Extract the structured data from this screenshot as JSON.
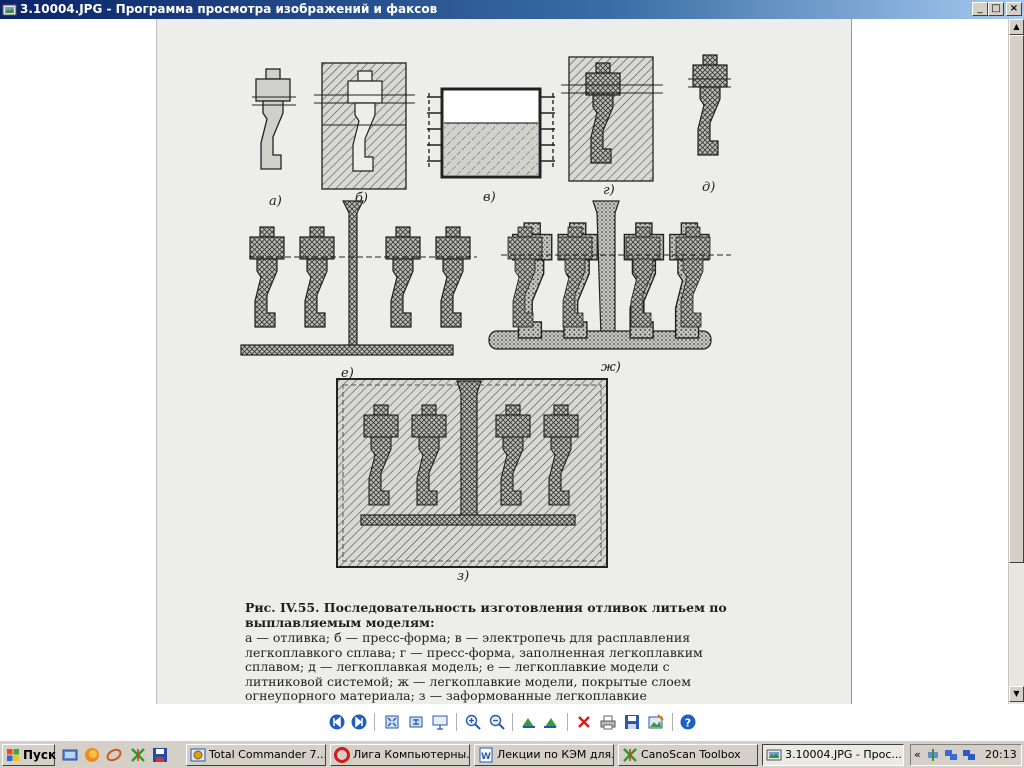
{
  "window": {
    "title": "3.10004.JPG - Программа просмотра изображений и факсов",
    "controls": {
      "minimize": "_",
      "maximize": "□",
      "close": "×"
    }
  },
  "figure": {
    "panel_labels": [
      "а)",
      "б)",
      "в)",
      "г)",
      "д)",
      "е)",
      "ж)",
      "з)"
    ],
    "caption_title": "Рис. IV.55. Последовательность изготовления отливок литьем по выплавляемым моделям:",
    "caption_body": "а — отливка; б — пресс-форма; в — электропечь для расплавления легкоплавкого сплава; г — пресс-форма, заполненная легкоплавким сплавом; д — легкоплавкая модель; е — легкоплавкие модели с литниковой системой; ж — легкоплавкие модели, покрытые слоем огнеупорного материала; з — заформованные легкоплавкие"
  },
  "scrollbar": {
    "up": "▲",
    "down": "▼"
  },
  "toolbar": {
    "icons": [
      "previous-image-icon",
      "next-image-icon",
      "best-fit-icon",
      "actual-size-icon",
      "slideshow-icon",
      "zoom-in-icon",
      "zoom-out-icon",
      "rotate-clockwise-icon",
      "rotate-counterclockwise-icon",
      "delete-icon",
      "print-icon",
      "save-copy-icon",
      "open-for-editing-icon",
      "help-icon"
    ]
  },
  "taskbar": {
    "start_label": "Пуск",
    "tasks": [
      {
        "label": "Total Commander 7....",
        "icon": "total-commander-icon"
      },
      {
        "label": "Лига Компьютерны...",
        "icon": "opera-icon"
      },
      {
        "label": "Лекции по КЭМ для...",
        "icon": "word-icon"
      },
      {
        "label": "CanoScan Toolbox",
        "icon": "canoscan-icon"
      },
      {
        "label": "3.10004.JPG - Прос...",
        "icon": "image-viewer-icon",
        "active": true
      }
    ],
    "tray": {
      "chevron": "«",
      "clock": "20:13"
    }
  }
}
